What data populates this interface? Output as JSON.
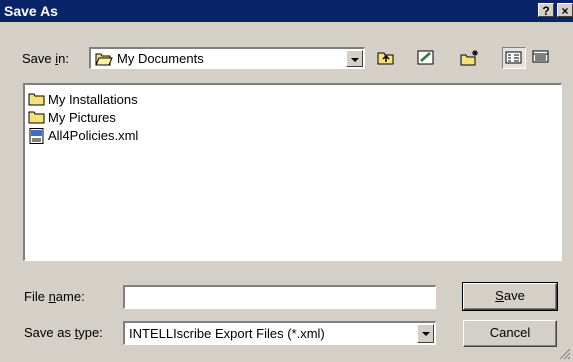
{
  "window": {
    "title": "Save As",
    "help_glyph": "?",
    "close_glyph": "×"
  },
  "location": {
    "label_prefix": "Save ",
    "label_underlined": "i",
    "label_suffix": "n:",
    "value": "My Documents"
  },
  "toolbar": {
    "buttons": [
      "up-one-level",
      "favorites",
      "new-folder",
      "list-view",
      "details-view"
    ]
  },
  "files": [
    {
      "name": "My Installations",
      "icon": "folder-icon"
    },
    {
      "name": "My Pictures",
      "icon": "folder-icon"
    },
    {
      "name": "All4Policies.xml",
      "icon": "xml-file-icon"
    }
  ],
  "filename": {
    "label_prefix": "File ",
    "label_underlined": "n",
    "label_suffix": "ame:",
    "value": ""
  },
  "filetype": {
    "label_prefix": "Save as ",
    "label_underlined": "t",
    "label_suffix": "ype:",
    "value": "INTELLIscribe Export Files (*.xml)"
  },
  "buttons": {
    "save_underlined": "S",
    "save_rest": "ave",
    "cancel": "Cancel"
  },
  "colors": {
    "titlebar": "#0a246a",
    "face": "#d4d0c8",
    "folder": "#f7e27a"
  }
}
